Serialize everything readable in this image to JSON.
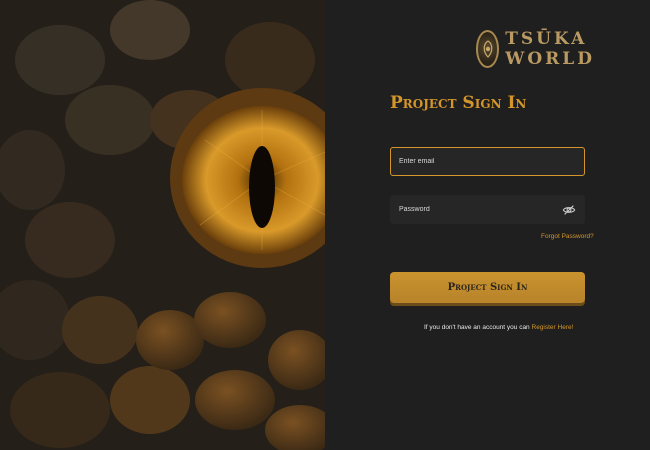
{
  "brand": {
    "name": "Tsūka World"
  },
  "form": {
    "title": "Project Sign In",
    "email_placeholder": "Enter email",
    "password_placeholder": "Password",
    "forgot_link": "Forgot Password?",
    "submit_label": "Project Sign In",
    "register_prompt": "If you don't have an account you can",
    "register_link": "Register Here!"
  },
  "colors": {
    "accent": "#d4962a",
    "panel_bg": "#1f1f1f",
    "field_bg": "#262626",
    "button_bg": "#c9932f"
  }
}
